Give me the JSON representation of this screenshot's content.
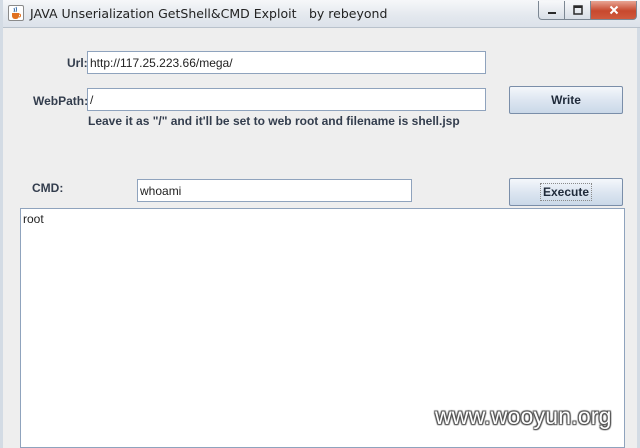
{
  "window": {
    "title": "JAVA Unserialization GetShell&CMD Exploit",
    "author": "by rebeyond",
    "icon": "java-cup-icon",
    "controls": {
      "minimize": "minimize-icon",
      "maximize": "maximize-icon",
      "close": "close-icon"
    }
  },
  "form": {
    "url_label": "Url:",
    "url_value": "http://117.25.223.66/mega/",
    "webpath_label": "WebPath:",
    "webpath_value": "/",
    "write_label": "Write",
    "hint": "Leave it as \"/\" and it'll be set to web root and filename is shell.jsp",
    "cmd_label": "CMD:",
    "cmd_value": "whoami",
    "execute_label": "Execute"
  },
  "output": {
    "text": "root"
  },
  "watermark": "www.wooyun.org",
  "colors": {
    "label": "#333d4d",
    "field_border": "#8fa3bd",
    "button_border": "#7a8ea9",
    "close_button": "#c7492e"
  }
}
